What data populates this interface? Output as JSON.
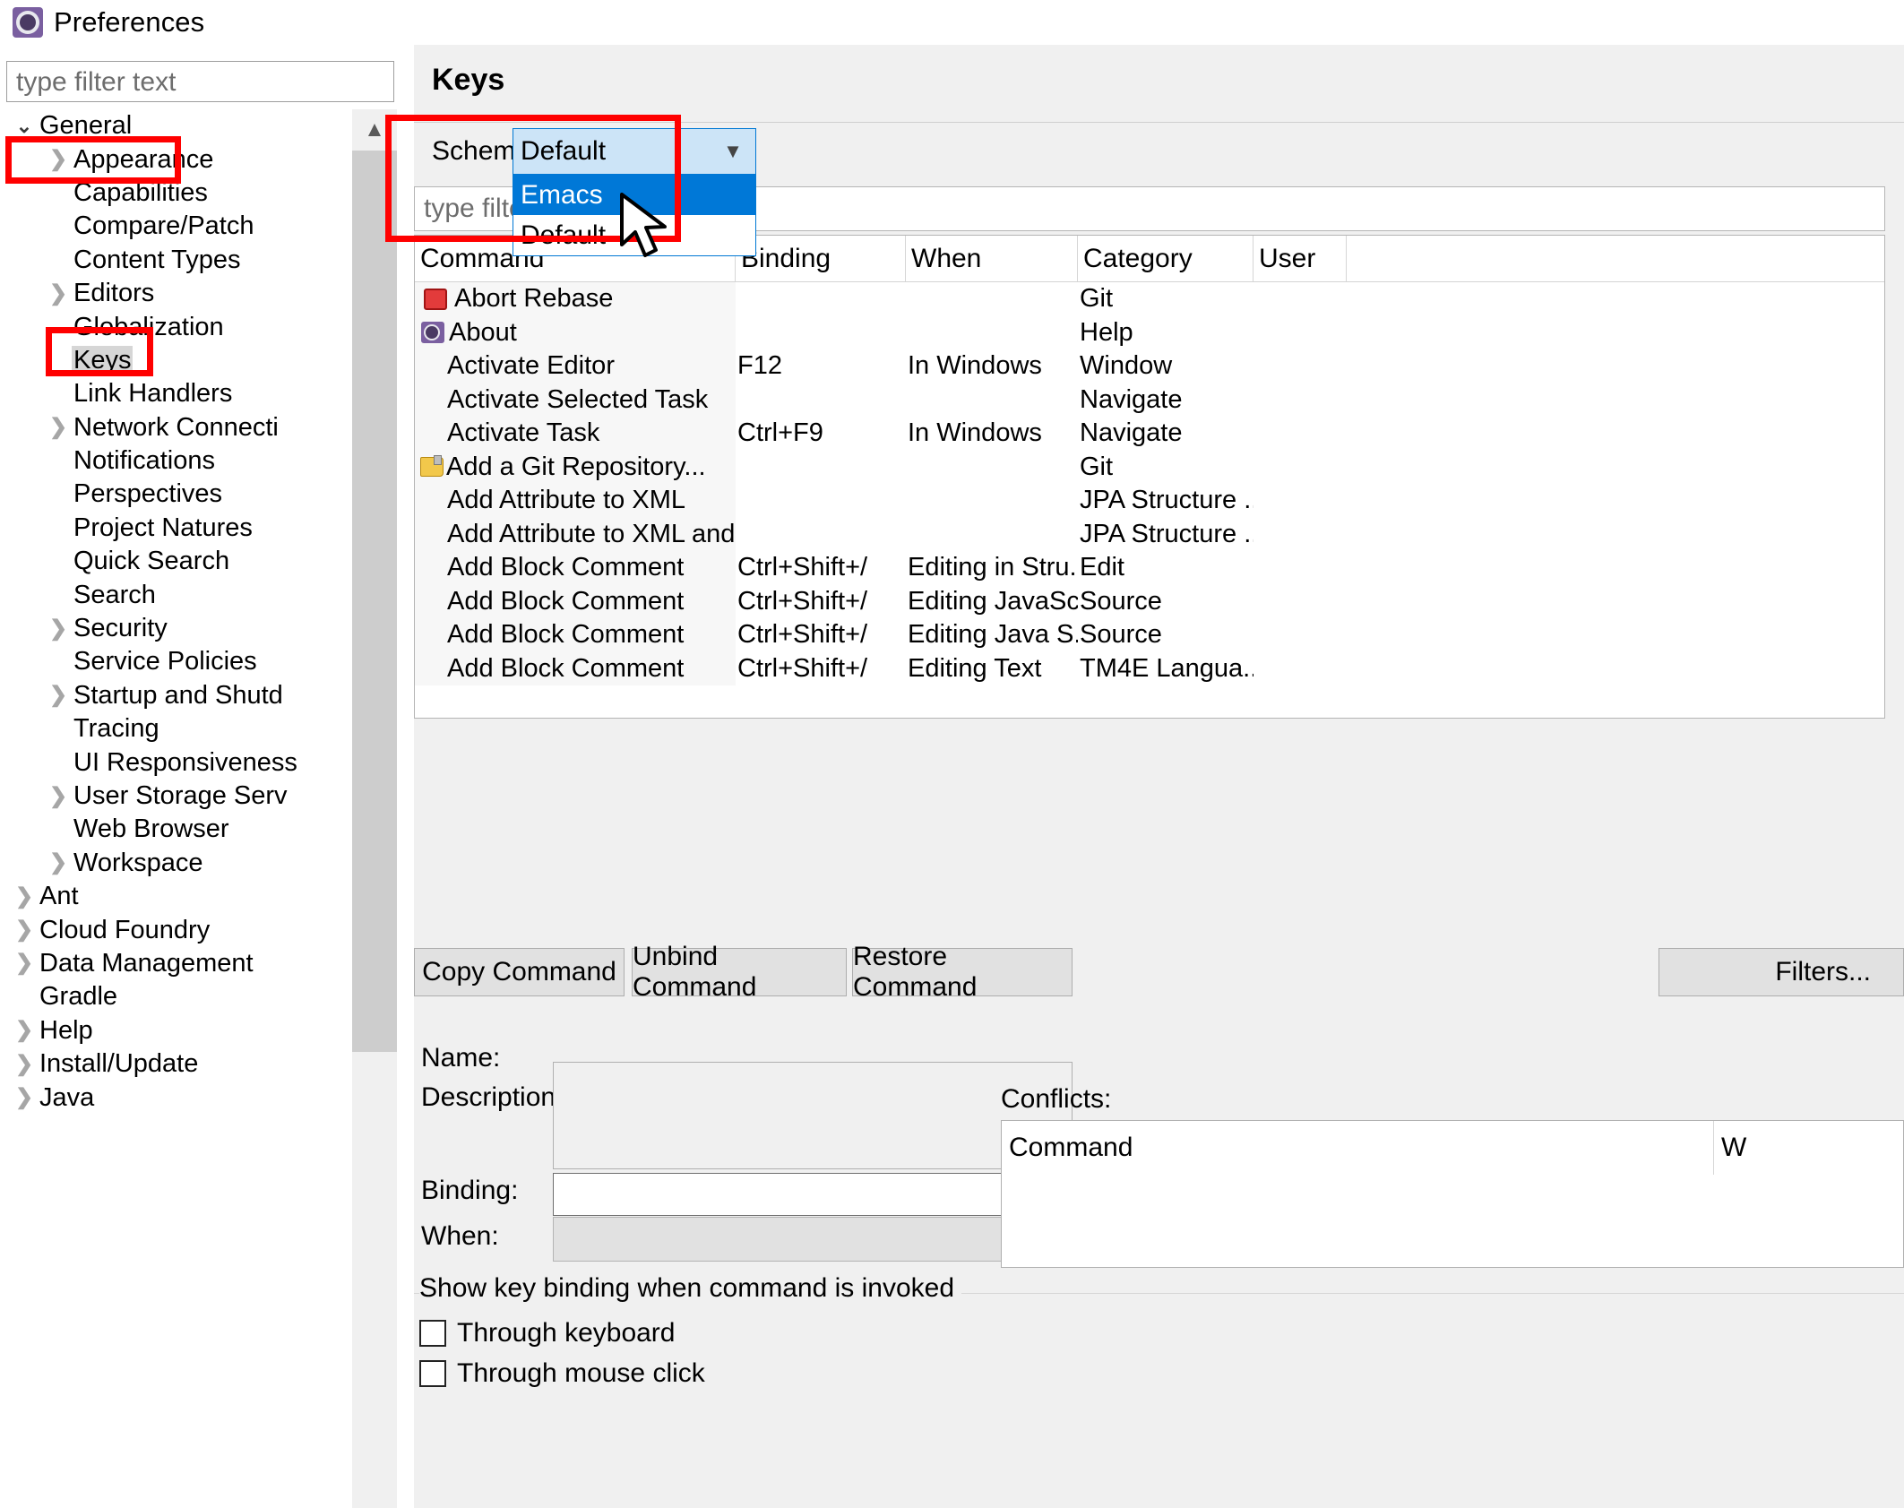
{
  "window": {
    "title": "Preferences",
    "icon": "preferences-gear-icon"
  },
  "sidebar": {
    "filter_placeholder": "type filter text",
    "items": [
      {
        "label": "General",
        "level": 0,
        "twisty": "open",
        "selected": false
      },
      {
        "label": "Appearance",
        "level": 1,
        "twisty": "closed",
        "selected": false
      },
      {
        "label": "Capabilities",
        "level": 1,
        "twisty": "none",
        "selected": false
      },
      {
        "label": "Compare/Patch",
        "level": 1,
        "twisty": "none",
        "selected": false
      },
      {
        "label": "Content Types",
        "level": 1,
        "twisty": "none",
        "selected": false
      },
      {
        "label": "Editors",
        "level": 1,
        "twisty": "closed",
        "selected": false
      },
      {
        "label": "Globalization",
        "level": 1,
        "twisty": "none",
        "selected": false
      },
      {
        "label": "Keys",
        "level": 1,
        "twisty": "none",
        "selected": true
      },
      {
        "label": "Link Handlers",
        "level": 1,
        "twisty": "none",
        "selected": false
      },
      {
        "label": "Network Connecti",
        "level": 1,
        "twisty": "closed",
        "selected": false
      },
      {
        "label": "Notifications",
        "level": 1,
        "twisty": "none",
        "selected": false
      },
      {
        "label": "Perspectives",
        "level": 1,
        "twisty": "none",
        "selected": false
      },
      {
        "label": "Project Natures",
        "level": 1,
        "twisty": "none",
        "selected": false
      },
      {
        "label": "Quick Search",
        "level": 1,
        "twisty": "none",
        "selected": false
      },
      {
        "label": "Search",
        "level": 1,
        "twisty": "none",
        "selected": false
      },
      {
        "label": "Security",
        "level": 1,
        "twisty": "closed",
        "selected": false
      },
      {
        "label": "Service Policies",
        "level": 1,
        "twisty": "none",
        "selected": false
      },
      {
        "label": "Startup and Shutd",
        "level": 1,
        "twisty": "closed",
        "selected": false
      },
      {
        "label": "Tracing",
        "level": 1,
        "twisty": "none",
        "selected": false
      },
      {
        "label": "UI Responsiveness",
        "level": 1,
        "twisty": "none",
        "selected": false
      },
      {
        "label": "User Storage Serv",
        "level": 1,
        "twisty": "closed",
        "selected": false
      },
      {
        "label": "Web Browser",
        "level": 1,
        "twisty": "none",
        "selected": false
      },
      {
        "label": "Workspace",
        "level": 1,
        "twisty": "closed",
        "selected": false
      },
      {
        "label": "Ant",
        "level": 0,
        "twisty": "closed",
        "selected": false
      },
      {
        "label": "Cloud Foundry",
        "level": 0,
        "twisty": "closed",
        "selected": false
      },
      {
        "label": "Data Management",
        "level": 0,
        "twisty": "closed",
        "selected": false
      },
      {
        "label": "Gradle",
        "level": 0,
        "twisty": "none",
        "selected": false
      },
      {
        "label": "Help",
        "level": 0,
        "twisty": "closed",
        "selected": false
      },
      {
        "label": "Install/Update",
        "level": 0,
        "twisty": "closed",
        "selected": false
      },
      {
        "label": "Java",
        "level": 0,
        "twisty": "closed",
        "selected": false
      }
    ]
  },
  "page": {
    "title": "Keys",
    "scheme_label": "Scheme:",
    "scheme_value": "Default",
    "scheme_options": [
      {
        "label": "Emacs",
        "highlighted": true
      },
      {
        "label": "Default",
        "highlighted": false
      }
    ],
    "table_filter_placeholder": "type filter text"
  },
  "table": {
    "columns": [
      "Command",
      "Binding",
      "When",
      "Category",
      "User"
    ],
    "sort_column": "Command",
    "sort_direction": "ascending",
    "rows": [
      {
        "icon": "git-abort-rebase-icon",
        "command": "Abort Rebase",
        "binding": "",
        "when": "",
        "category": "Git",
        "user": ""
      },
      {
        "icon": "about-eclipse-icon",
        "command": "About",
        "binding": "",
        "when": "",
        "category": "Help",
        "user": ""
      },
      {
        "icon": "none",
        "command": "Activate Editor",
        "binding": "F12",
        "when": "In Windows",
        "category": "Window",
        "user": ""
      },
      {
        "icon": "none",
        "command": "Activate Selected Task",
        "binding": "",
        "when": "",
        "category": "Navigate",
        "user": ""
      },
      {
        "icon": "none",
        "command": "Activate Task",
        "binding": "Ctrl+F9",
        "when": "In Windows",
        "category": "Navigate",
        "user": ""
      },
      {
        "icon": "git-repository-icon",
        "command": "Add a Git Repository...",
        "binding": "",
        "when": "",
        "category": "Git",
        "user": ""
      },
      {
        "icon": "none",
        "command": "Add Attribute to XML",
        "binding": "",
        "when": "",
        "category": "JPA Structure ...",
        "user": ""
      },
      {
        "icon": "none",
        "command": "Add Attribute to XML and",
        "binding": "",
        "when": "",
        "category": "JPA Structure ...",
        "user": ""
      },
      {
        "icon": "none",
        "command": "Add Block Comment",
        "binding": "Ctrl+Shift+/",
        "when": "Editing in Stru...",
        "category": "Edit",
        "user": ""
      },
      {
        "icon": "none",
        "command": "Add Block Comment",
        "binding": "Ctrl+Shift+/",
        "when": "Editing JavaSc...",
        "category": "Source",
        "user": ""
      },
      {
        "icon": "none",
        "command": "Add Block Comment",
        "binding": "Ctrl+Shift+/",
        "when": "Editing Java S...",
        "category": "Source",
        "user": ""
      },
      {
        "icon": "none",
        "command": "Add Block Comment",
        "binding": "Ctrl+Shift+/",
        "when": "Editing Text",
        "category": "TM4E Langua...",
        "user": ""
      }
    ]
  },
  "buttons": {
    "copy_command": "Copy Command",
    "unbind_command": "Unbind Command",
    "restore_command": "Restore Command",
    "filters": "Filters..."
  },
  "details": {
    "name_label": "Name:",
    "name_value": "",
    "description_label": "Description:",
    "description_value": "",
    "binding_label": "Binding:",
    "binding_value": "",
    "when_label": "When:",
    "when_value": "",
    "conflicts_label": "Conflicts:",
    "conflicts_columns": [
      "Command",
      "W"
    ]
  },
  "show_group": {
    "legend": "Show key binding when command is invoked",
    "checkboxes": [
      {
        "label": "Through keyboard",
        "checked": false
      },
      {
        "label": "Through mouse click",
        "checked": false
      }
    ]
  },
  "colors": {
    "annotation": "#ff0000",
    "highlight": "#0078d7",
    "combo_bg": "#cce4f7",
    "panel_bg": "#f0f0f0"
  }
}
